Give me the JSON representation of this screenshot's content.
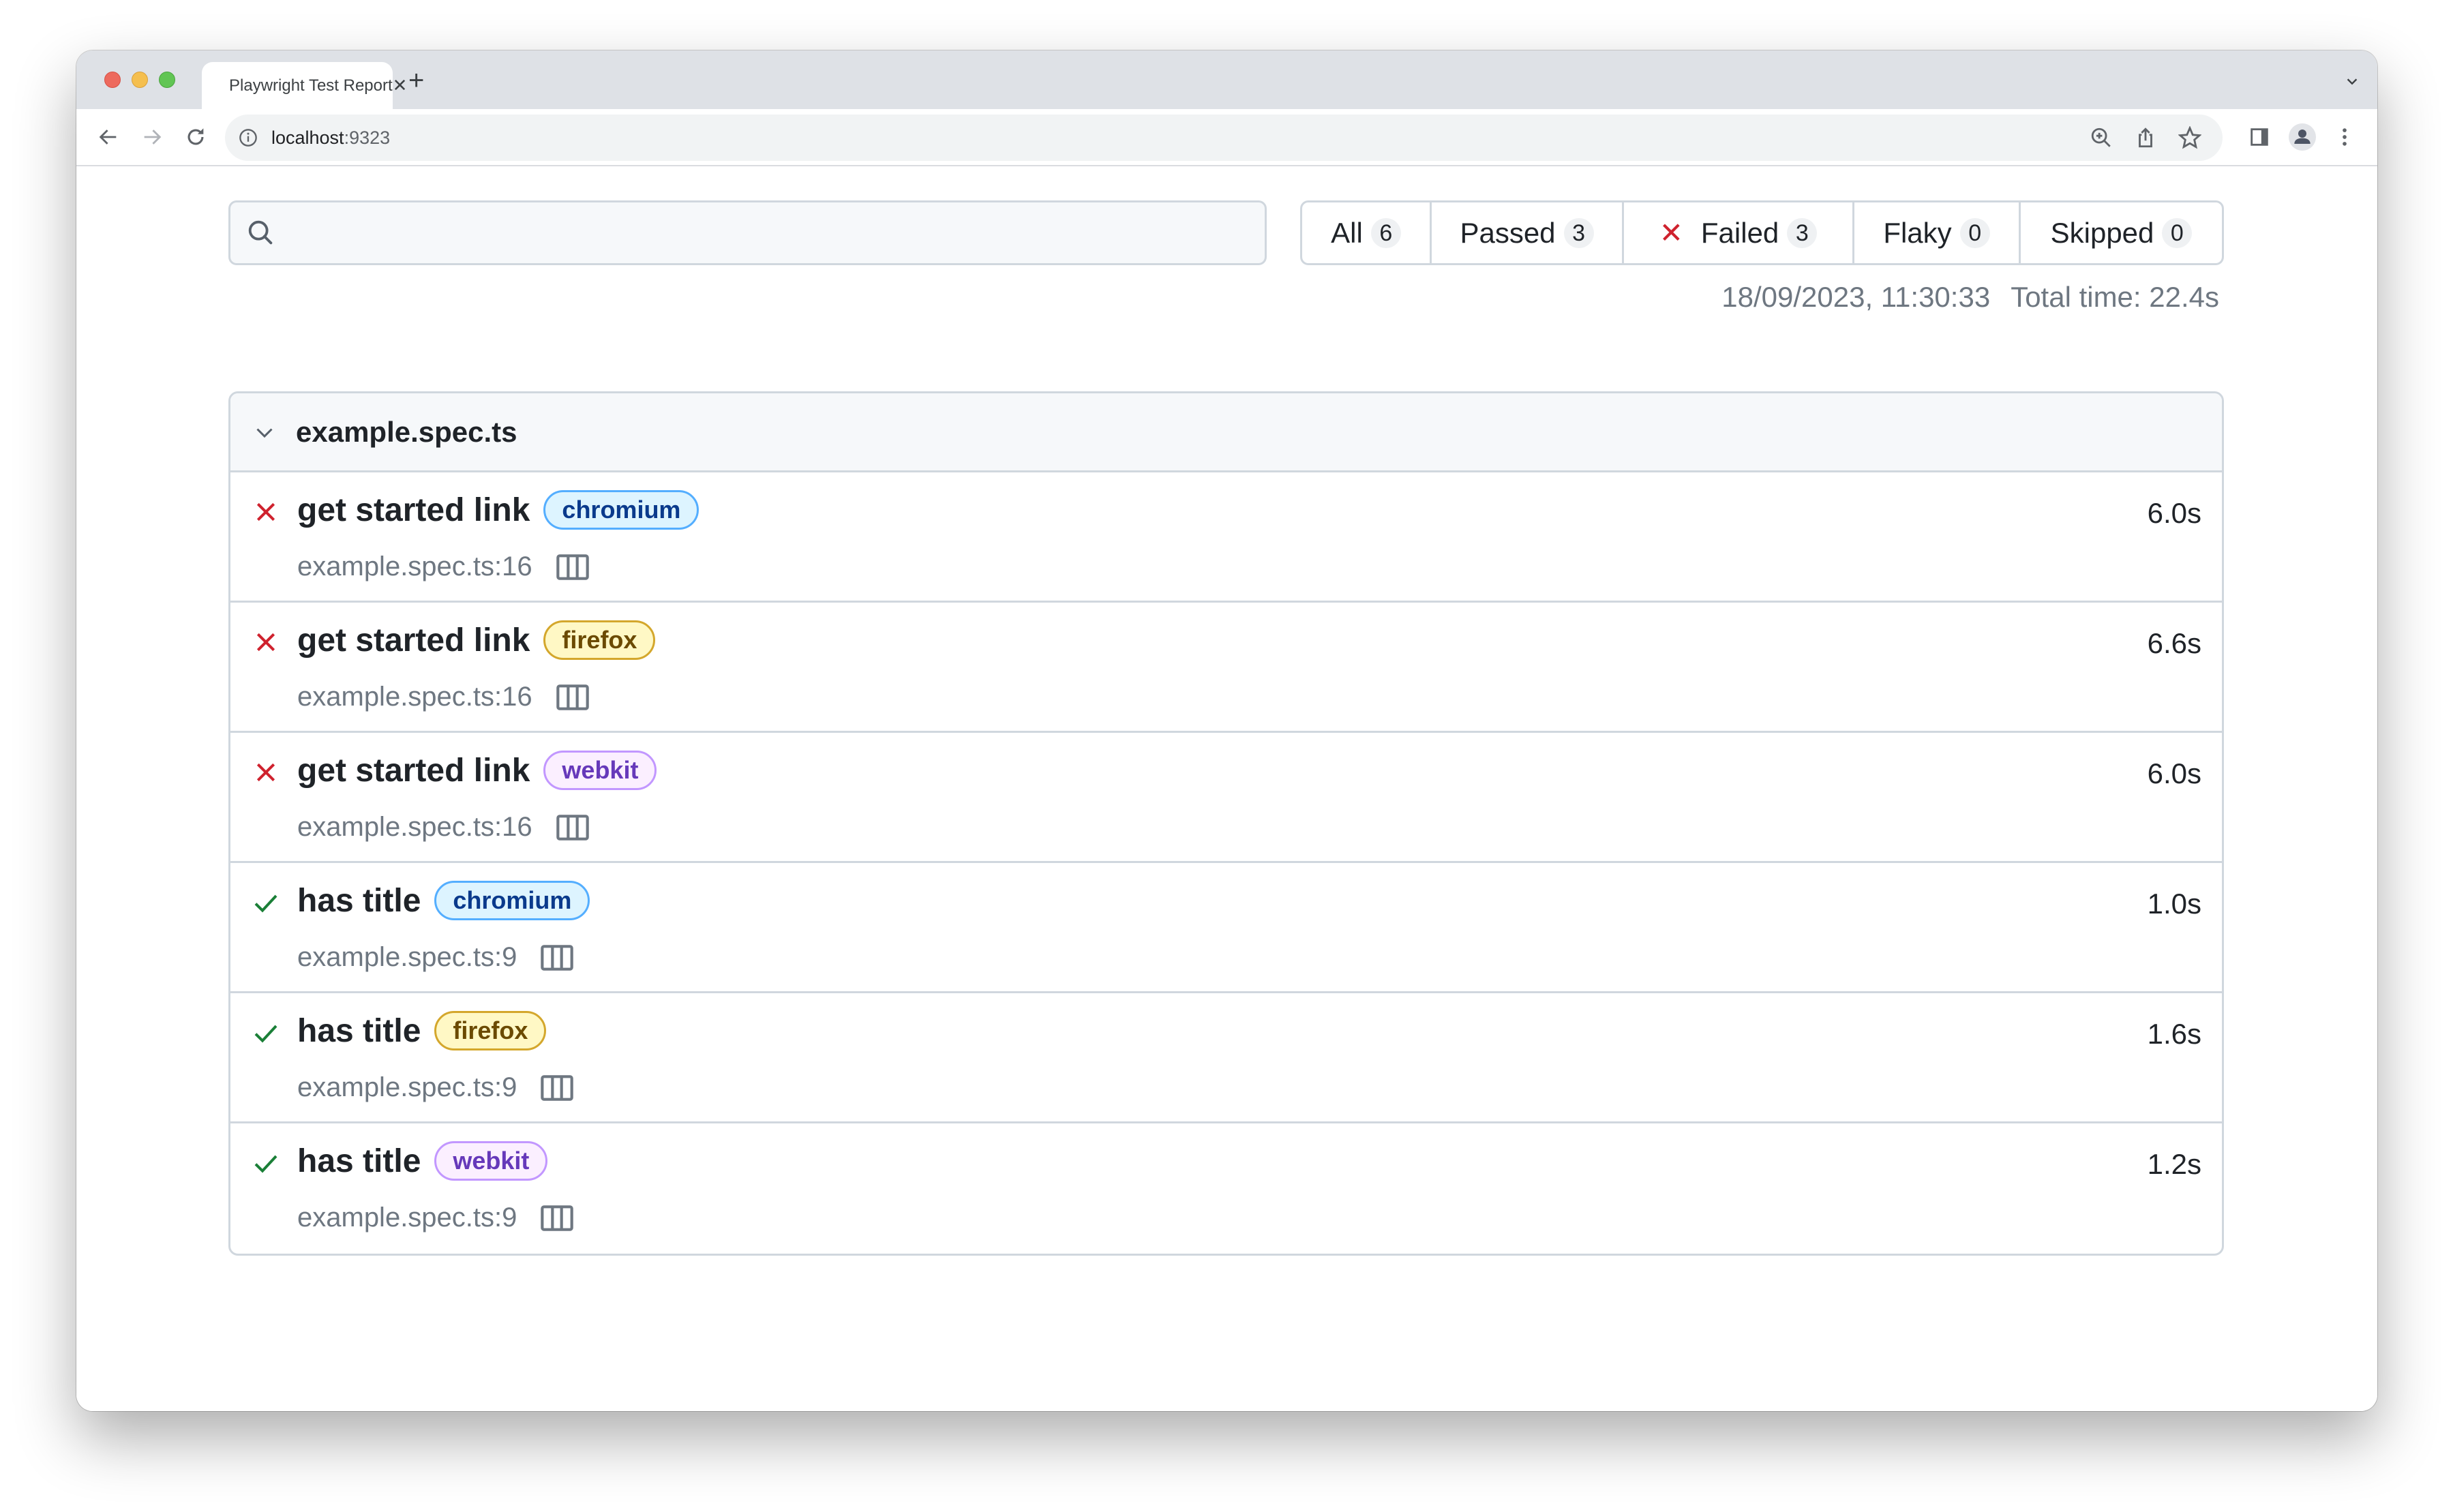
{
  "browser": {
    "tab_title": "Playwright Test Report",
    "url_host": "localhost",
    "url_port": ":9323"
  },
  "search": {
    "placeholder": "",
    "value": ""
  },
  "filters": [
    {
      "label": "All",
      "count": "6"
    },
    {
      "label": "Passed",
      "count": "3"
    },
    {
      "label": "Failed",
      "count": "3"
    },
    {
      "label": "Flaky",
      "count": "0"
    },
    {
      "label": "Skipped",
      "count": "0"
    }
  ],
  "meta": {
    "timestamp": "18/09/2023, 11:30:33",
    "total_time": "Total time: 22.4s"
  },
  "file_group": {
    "name": "example.spec.ts",
    "tests": [
      {
        "status": "failed",
        "title": "get started link",
        "project": "chromium",
        "location": "example.spec.ts:16",
        "duration": "6.0s"
      },
      {
        "status": "failed",
        "title": "get started link",
        "project": "firefox",
        "location": "example.spec.ts:16",
        "duration": "6.6s"
      },
      {
        "status": "failed",
        "title": "get started link",
        "project": "webkit",
        "location": "example.spec.ts:16",
        "duration": "6.0s"
      },
      {
        "status": "passed",
        "title": "has title",
        "project": "chromium",
        "location": "example.spec.ts:9",
        "duration": "1.0s"
      },
      {
        "status": "passed",
        "title": "has title",
        "project": "firefox",
        "location": "example.spec.ts:9",
        "duration": "1.6s"
      },
      {
        "status": "passed",
        "title": "has title",
        "project": "webkit",
        "location": "example.spec.ts:9",
        "duration": "1.2s"
      }
    ]
  },
  "colors": {
    "failed": "#cf222e",
    "passed": "#1a7f37",
    "border": "#d0d7de",
    "muted_text": "#6e7781"
  }
}
